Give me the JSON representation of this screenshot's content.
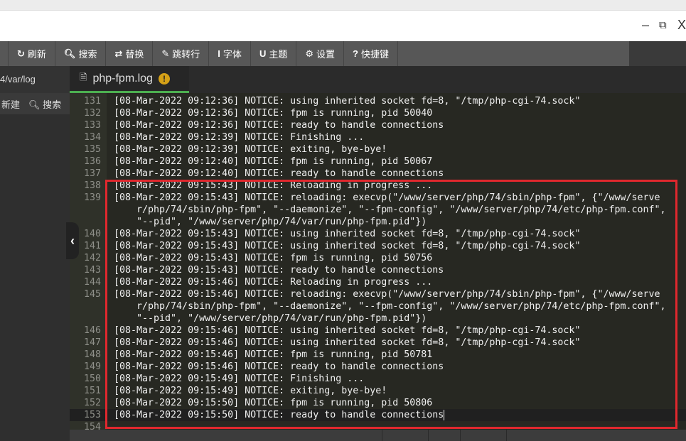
{
  "window": {
    "minimize": "–",
    "restore": "⧉",
    "close": "X"
  },
  "toolbar": {
    "items": [
      {
        "icon": "↻",
        "label": "刷新"
      },
      {
        "icon": "🔍︎",
        "label": "搜索"
      },
      {
        "icon": "⇄",
        "label": "替换"
      },
      {
        "icon": "✎",
        "label": "跳转行"
      },
      {
        "icon": "I",
        "label": "字体"
      },
      {
        "icon": "U",
        "label": "主题"
      },
      {
        "icon": "⚙",
        "label": "设置"
      },
      {
        "icon": "?",
        "label": "快捷键"
      }
    ]
  },
  "sidebar": {
    "path": "4/var/log",
    "new_label": "新建",
    "search_label": "搜索"
  },
  "tab": {
    "label": "php-fpm.log",
    "status_icon": "!"
  },
  "colors": {
    "highlight_box": "#e0282e",
    "tab_active_underline": "#4caf50",
    "editor_bg": "#272822"
  },
  "editor": {
    "lines": [
      {
        "n": "131",
        "t": "[08-Mar-2022 09:12:36] NOTICE: using inherited socket fd=8, \"/tmp/php-cgi-74.sock\""
      },
      {
        "n": "132",
        "t": "[08-Mar-2022 09:12:36] NOTICE: fpm is running, pid 50040"
      },
      {
        "n": "133",
        "t": "[08-Mar-2022 09:12:36] NOTICE: ready to handle connections"
      },
      {
        "n": "134",
        "t": "[08-Mar-2022 09:12:39] NOTICE: Finishing ..."
      },
      {
        "n": "135",
        "t": "[08-Mar-2022 09:12:39] NOTICE: exiting, bye-bye!"
      },
      {
        "n": "136",
        "t": "[08-Mar-2022 09:12:40] NOTICE: fpm is running, pid 50067"
      },
      {
        "n": "137",
        "t": "[08-Mar-2022 09:12:40] NOTICE: ready to handle connections"
      },
      {
        "n": "138",
        "t": "[08-Mar-2022 09:15:43] NOTICE: Reloading in progress ..."
      },
      {
        "n": "139",
        "t": "[08-Mar-2022 09:15:43] NOTICE: reloading: execvp(\"/www/server/php/74/sbin/php-fpm\", {\"/www/server/php/74/sbin/php-fpm\", \"--daemonize\", \"--fpm-config\", \"/www/server/php/74/etc/php-fpm.conf\", \"--pid\", \"/www/server/php/74/var/run/php-fpm.pid\"})"
      },
      {
        "n": "140",
        "t": "[08-Mar-2022 09:15:43] NOTICE: using inherited socket fd=8, \"/tmp/php-cgi-74.sock\""
      },
      {
        "n": "141",
        "t": "[08-Mar-2022 09:15:43] NOTICE: using inherited socket fd=8, \"/tmp/php-cgi-74.sock\""
      },
      {
        "n": "142",
        "t": "[08-Mar-2022 09:15:43] NOTICE: fpm is running, pid 50756"
      },
      {
        "n": "143",
        "t": "[08-Mar-2022 09:15:43] NOTICE: ready to handle connections"
      },
      {
        "n": "144",
        "t": "[08-Mar-2022 09:15:46] NOTICE: Reloading in progress ..."
      },
      {
        "n": "145",
        "t": "[08-Mar-2022 09:15:46] NOTICE: reloading: execvp(\"/www/server/php/74/sbin/php-fpm\", {\"/www/server/php/74/sbin/php-fpm\", \"--daemonize\", \"--fpm-config\", \"/www/server/php/74/etc/php-fpm.conf\", \"--pid\", \"/www/server/php/74/var/run/php-fpm.pid\"})"
      },
      {
        "n": "146",
        "t": "[08-Mar-2022 09:15:46] NOTICE: using inherited socket fd=8, \"/tmp/php-cgi-74.sock\""
      },
      {
        "n": "147",
        "t": "[08-Mar-2022 09:15:46] NOTICE: using inherited socket fd=8, \"/tmp/php-cgi-74.sock\""
      },
      {
        "n": "148",
        "t": "[08-Mar-2022 09:15:46] NOTICE: fpm is running, pid 50781"
      },
      {
        "n": "149",
        "t": "[08-Mar-2022 09:15:46] NOTICE: ready to handle connections"
      },
      {
        "n": "150",
        "t": "[08-Mar-2022 09:15:49] NOTICE: Finishing ..."
      },
      {
        "n": "151",
        "t": "[08-Mar-2022 09:15:49] NOTICE: exiting, bye-bye!"
      },
      {
        "n": "152",
        "t": "[08-Mar-2022 09:15:50] NOTICE: fpm is running, pid 50806"
      },
      {
        "n": "153",
        "t": "[08-Mar-2022 09:15:50] NOTICE: ready to handle connections",
        "cursor": true
      },
      {
        "n": "154",
        "t": ""
      }
    ]
  }
}
